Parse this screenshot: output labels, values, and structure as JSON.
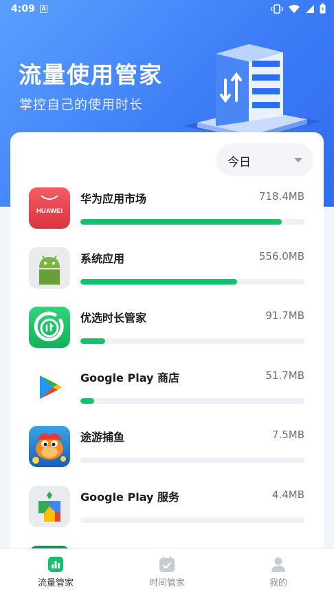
{
  "status_bar": {
    "time": "4:09",
    "notification": "A"
  },
  "header": {
    "title": "流量使用管家",
    "subtitle": "掌控自己的使用时长"
  },
  "period_select": {
    "selected": "今日"
  },
  "apps": [
    {
      "name": "华为应用市场",
      "usage": "718.4MB",
      "fraction": 0.9,
      "icon": "huawei-appgallery-icon",
      "icon_text": "HUAWEI"
    },
    {
      "name": "系统应用",
      "usage": "556.0MB",
      "fraction": 0.7,
      "icon": "android-icon"
    },
    {
      "name": "优选时长管家",
      "usage": "91.7MB",
      "fraction": 0.11,
      "icon": "time-manager-icon"
    },
    {
      "name": "Google Play 商店",
      "usage": "51.7MB",
      "fraction": 0.06,
      "icon": "google-play-store-icon"
    },
    {
      "name": "途游捕鱼",
      "usage": "7.5MB",
      "fraction": 0,
      "icon": "fishing-game-icon"
    },
    {
      "name": "Google Play 服务",
      "usage": "4.4MB",
      "fraction": 0,
      "icon": "google-play-services-icon"
    },
    {
      "name": "",
      "usage": "",
      "fraction": 0,
      "icon": "partial-app-icon"
    }
  ],
  "tabs": [
    {
      "label": "流量管家",
      "icon": "bar-chart-icon",
      "active": true
    },
    {
      "label": "时间管家",
      "icon": "calendar-check-icon",
      "active": false
    },
    {
      "label": "我的",
      "icon": "user-icon",
      "active": false
    }
  ],
  "colors": {
    "accent_blue": "#3d7df6",
    "bar_green": "#14c06c",
    "track": "#eef0f5"
  }
}
